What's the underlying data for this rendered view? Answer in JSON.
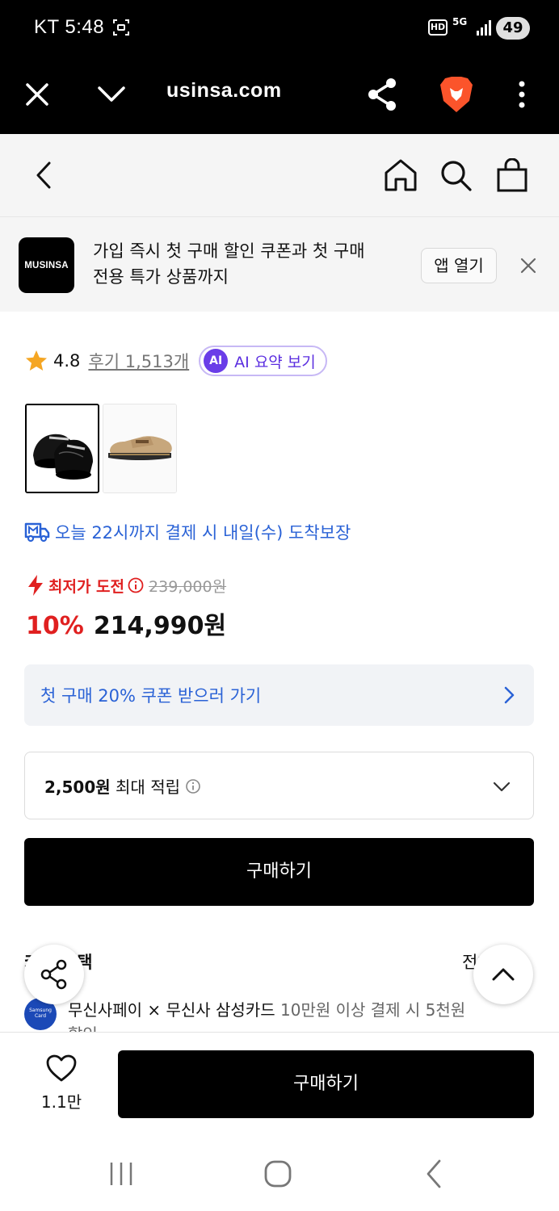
{
  "status_bar": {
    "carrier_time": "KT 5:48",
    "hd_label": "HD",
    "network": "5G",
    "battery": "49"
  },
  "browser": {
    "url": "usinsa.com"
  },
  "promo": {
    "logo_text": "MUSINSA",
    "line1": "가입 즉시 첫 구매 할인 쿠폰과 첫 구매",
    "line2": "전용 특가 상품까지",
    "open_app": "앱 열기"
  },
  "rating": {
    "score": "4.8",
    "reviews": "후기 1,513개",
    "ai_badge": "AI",
    "ai_summary": "AI 요약 보기"
  },
  "delivery": {
    "text": "오늘 22시까지 결제 시 내일(수) 도착보장"
  },
  "price": {
    "challenge_label": "최저가 도전",
    "original": "239,000원",
    "discount": "10%",
    "sale": "214,990원"
  },
  "coupon": {
    "label": "첫 구매 20% 쿠폰 받으러 가기"
  },
  "points": {
    "amount": "2,500원",
    "label": "최대 적립"
  },
  "actions": {
    "buy_label": "구매하기",
    "like_count": "1.1만"
  },
  "benefits": {
    "title": "카드 혜택",
    "view_all": "전체보기",
    "card_logo": "Samsung Card",
    "line_main": "무신사페이 × 무신사 삼성카드",
    "line_grey": "10만원 이상 결제 시 5천원",
    "line_cont": "할인"
  }
}
